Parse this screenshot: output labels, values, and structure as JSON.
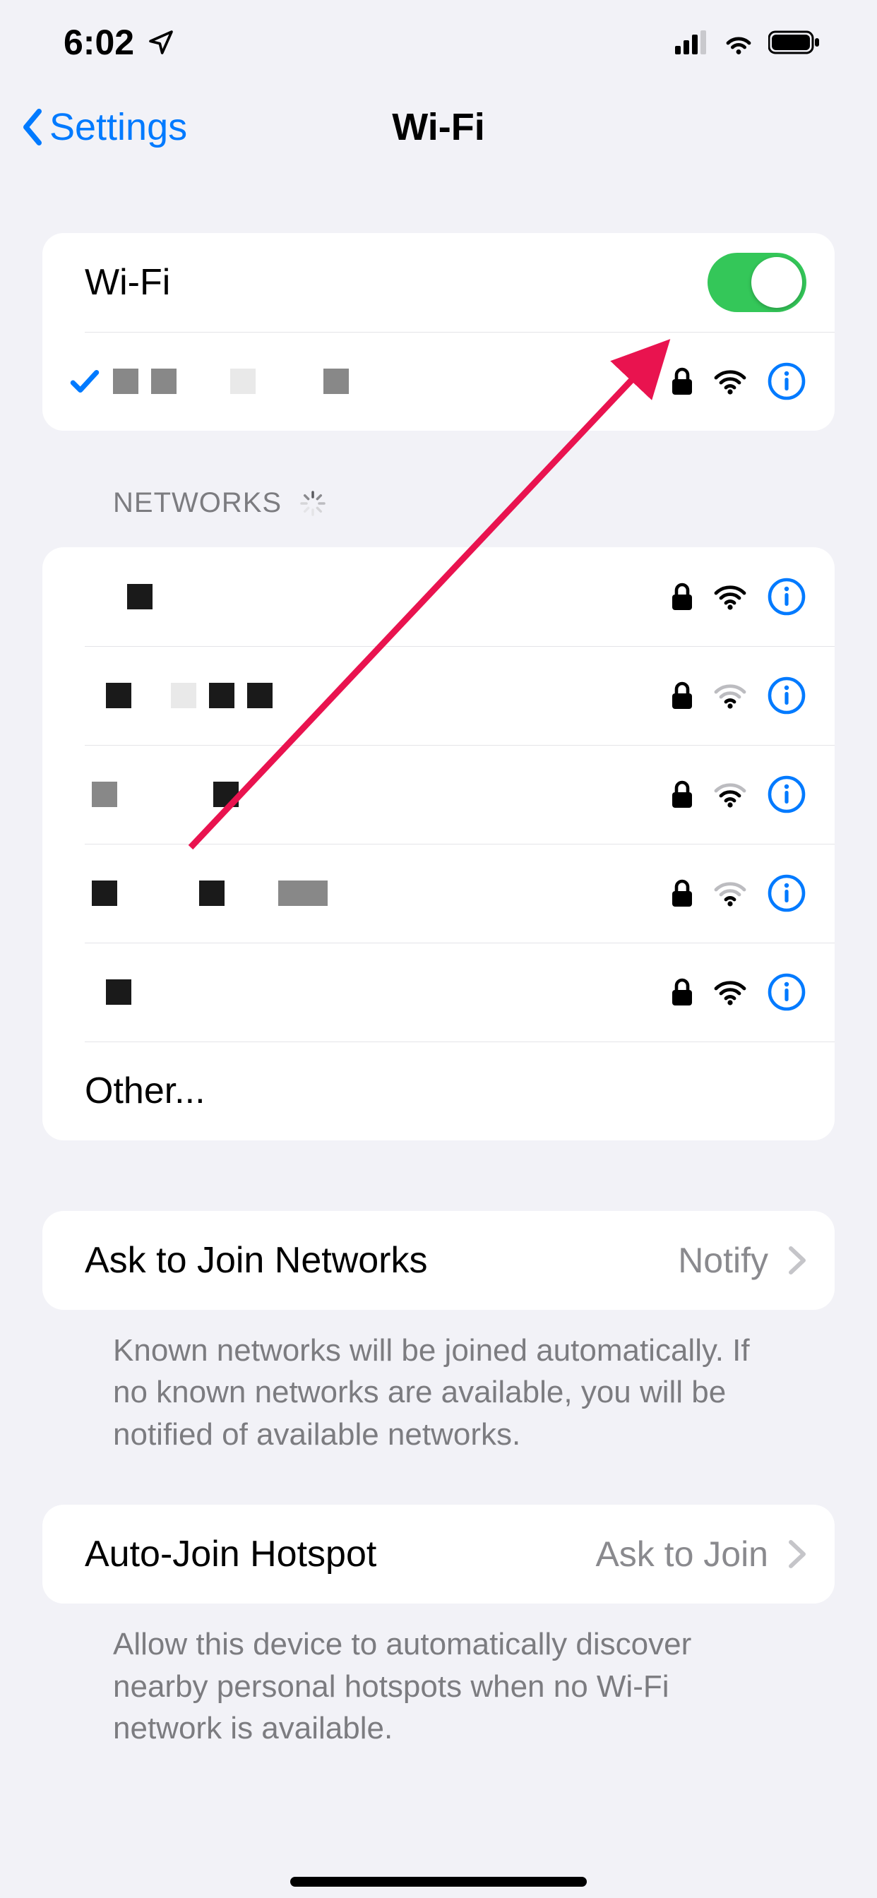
{
  "statusbar": {
    "time": "6:02"
  },
  "nav": {
    "back_label": "Settings",
    "title": "Wi-Fi"
  },
  "wifi_toggle": {
    "label": "Wi-Fi",
    "on": true
  },
  "connected_network": {
    "name_redacted": true
  },
  "networks_header": "NETWORKS",
  "networks": [
    {
      "name_redacted": true,
      "signal": "strong"
    },
    {
      "name_redacted": true,
      "signal": "weak"
    },
    {
      "name_redacted": true,
      "signal": "medium"
    },
    {
      "name_redacted": true,
      "signal": "weak"
    },
    {
      "name_redacted": true,
      "signal": "strong"
    }
  ],
  "other_label": "Other...",
  "ask_join": {
    "label": "Ask to Join Networks",
    "value": "Notify",
    "footer": "Known networks will be joined automatically. If no known networks are available, you will be notified of available networks."
  },
  "auto_hotspot": {
    "label": "Auto-Join Hotspot",
    "value": "Ask to Join",
    "footer": "Allow this device to automatically discover nearby personal hotspots when no Wi-Fi network is available."
  }
}
